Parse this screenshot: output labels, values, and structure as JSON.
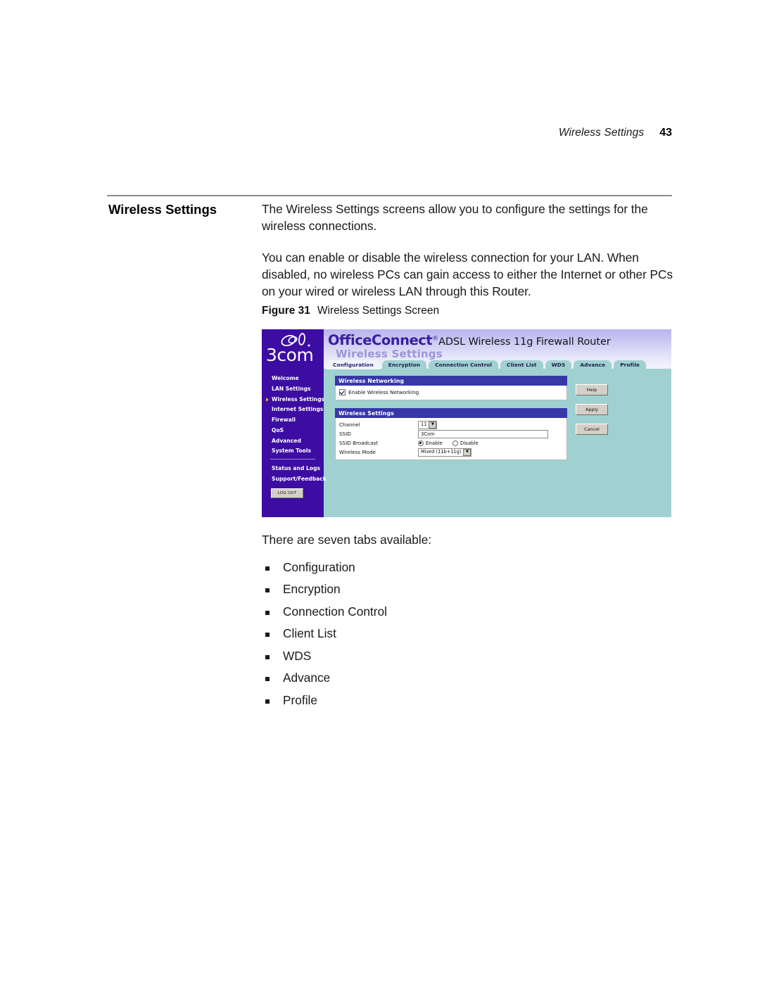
{
  "page": {
    "running_head_title": "Wireless Settings",
    "page_number": "43"
  },
  "section": {
    "heading": "Wireless Settings",
    "paragraphs": [
      "The Wireless Settings screens allow you to configure the settings for the wireless connections.",
      "You can enable or disable the wireless connection for your LAN. When disabled, no wireless PCs can gain access to either the Internet or other PCs on your wired or wireless LAN through this Router."
    ]
  },
  "figure": {
    "label": "Figure 31",
    "caption": "Wireless Settings Screen"
  },
  "screenshot": {
    "brand": {
      "logo_text": "3com",
      "logo_icon": "3com-audio-logo-icon"
    },
    "header": {
      "product_name": "OfficeConnect",
      "registered_mark": "®",
      "product_model": "ADSL Wireless 11g Firewall Router",
      "page_title": "Wireless Settings"
    },
    "tabs": [
      {
        "label": "Configuration",
        "active": true
      },
      {
        "label": "Encryption",
        "active": false
      },
      {
        "label": "Connection Control",
        "active": false
      },
      {
        "label": "Client List",
        "active": false
      },
      {
        "label": "WDS",
        "active": false
      },
      {
        "label": "Advance",
        "active": false
      },
      {
        "label": "Profile",
        "active": false
      }
    ],
    "nav": {
      "items": [
        {
          "label": "Welcome",
          "current": false
        },
        {
          "label": "LAN Settings",
          "current": false
        },
        {
          "label": "Wireless Settings",
          "current": true
        },
        {
          "label": "Internet Settings",
          "current": false
        },
        {
          "label": "Firewall",
          "current": false
        },
        {
          "label": "QoS",
          "current": false
        },
        {
          "label": "Advanced",
          "current": false
        },
        {
          "label": "System Tools",
          "current": false
        }
      ],
      "secondary_items": [
        {
          "label": "Status and Logs"
        },
        {
          "label": "Support/Feedback"
        }
      ],
      "logout_label": "LOG OUT"
    },
    "panels": {
      "networking": {
        "title": "Wireless Networking",
        "checkbox_label": "Enable Wireless Networking",
        "checkbox_checked": "true"
      },
      "settings": {
        "title": "Wireless Settings",
        "rows": {
          "channel_label": "Channel",
          "channel_value": "11",
          "ssid_label": "SSID",
          "ssid_value": "3Com",
          "ssid_broadcast_label": "SSID Broadcast",
          "ssid_broadcast_enable": "Enable",
          "ssid_broadcast_disable": "Disable",
          "wireless_mode_label": "Wireless Mode",
          "wireless_mode_value": "Mixed (11b+11g)"
        }
      }
    },
    "actions": {
      "help": "Help",
      "apply": "Apply",
      "cancel": "Cancel"
    },
    "colors": {
      "sidebar_purple": "#3c0ca3",
      "content_teal": "#9fd1d1",
      "panel_header_blue": "#3737a8",
      "brand_purple": "#3a1f9e",
      "current_marker_orange": "#f5a623"
    }
  },
  "tabs_section": {
    "intro": "There are seven tabs available:",
    "items": [
      "Configuration",
      "Encryption",
      "Connection Control",
      "Client List",
      "WDS",
      "Advance",
      "Profile"
    ]
  }
}
